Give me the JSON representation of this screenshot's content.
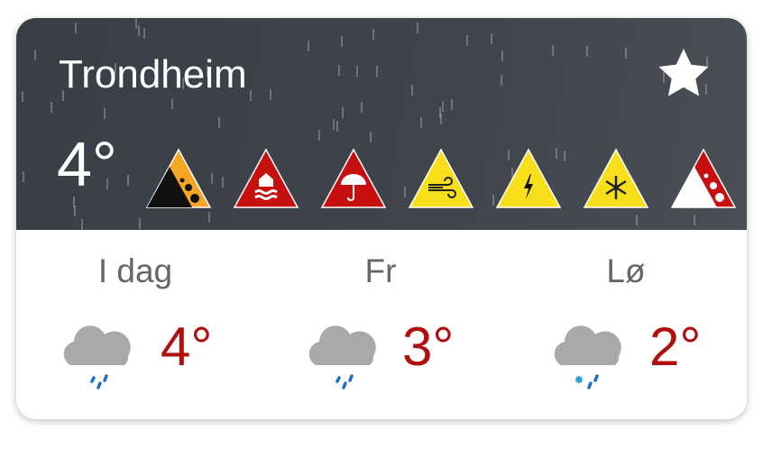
{
  "location": {
    "city": "Trondheim",
    "current_temp": "4°"
  },
  "favorite_icon": "star-icon",
  "warnings": [
    {
      "type": "landslide",
      "color": "#f5a623"
    },
    {
      "type": "flood",
      "color": "#c80f0f"
    },
    {
      "type": "rain",
      "color": "#c80f0f"
    },
    {
      "type": "wind",
      "color": "#f7e01b"
    },
    {
      "type": "lightning",
      "color": "#f7e01b"
    },
    {
      "type": "snow",
      "color": "#f7e01b"
    },
    {
      "type": "avalanche",
      "color": "#c80f0f"
    }
  ],
  "forecast": [
    {
      "day": "I dag",
      "temp": "4°",
      "icon": "rain-cloud-icon"
    },
    {
      "day": "Fr",
      "temp": "3°",
      "icon": "rain-cloud-icon"
    },
    {
      "day": "Lø",
      "temp": "2°",
      "icon": "sleet-cloud-icon"
    }
  ],
  "colors": {
    "temp": "#b00f0f",
    "raindrop": "#1f6fc4"
  }
}
